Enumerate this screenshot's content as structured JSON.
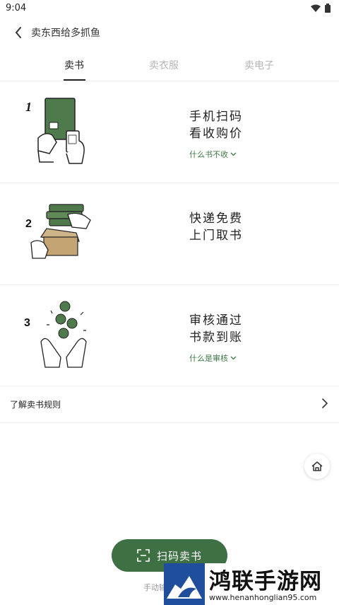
{
  "status_bar": {
    "time": "9:04"
  },
  "header": {
    "title": "卖东西给多抓鱼"
  },
  "tabs": [
    {
      "label": "卖书",
      "active": true
    },
    {
      "label": "卖衣服",
      "active": false
    },
    {
      "label": "卖电子",
      "active": false
    }
  ],
  "steps": [
    {
      "number": "1",
      "line1": "手机扫码",
      "line2": "看收购价",
      "link": "什么书不收"
    },
    {
      "number": "2",
      "line1": "快递免费",
      "line2": "上门取书",
      "link": ""
    },
    {
      "number": "3",
      "line1": "审核通过",
      "line2": "书款到账",
      "link": "什么是审核"
    }
  ],
  "rules": {
    "label": "了解卖书规则"
  },
  "scan_button": {
    "label": "扫码卖书"
  },
  "manual_link": {
    "label": "手动输"
  },
  "watermark": {
    "title": "鸿联手游网",
    "url": "www.henanhonglian95.com"
  },
  "colors": {
    "accent": "#3e7044",
    "link_green": "#3e7a46",
    "tab_inactive": "#b5b5b5",
    "watermark_blue": "#1f4f9c"
  },
  "icons": [
    "back-arrow-icon",
    "wifi-icon",
    "battery-icon",
    "chevron-down-icon",
    "chevron-right-icon",
    "home-icon",
    "scan-icon"
  ]
}
